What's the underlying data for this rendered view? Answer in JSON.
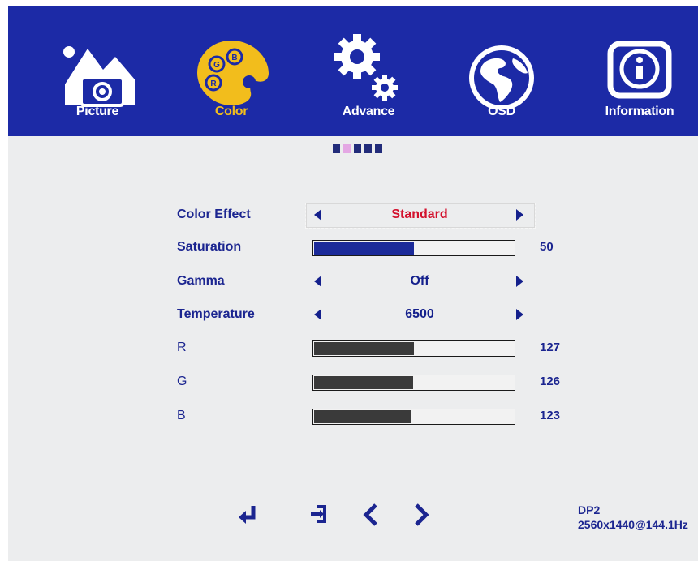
{
  "tabs": [
    {
      "label": "Picture",
      "icon": "picture-icon"
    },
    {
      "label": "Color",
      "icon": "palette-icon"
    },
    {
      "label": "Advance",
      "icon": "gears-icon"
    },
    {
      "label": "OSD",
      "icon": "globe-icon"
    },
    {
      "label": "Information",
      "icon": "info-icon"
    }
  ],
  "active_tab": "Color",
  "page_indicator": {
    "count": 5,
    "active_index": 1
  },
  "colors": {
    "bar_background": "#1c2aa6",
    "active_tab": "#f2bd1c",
    "selected_value": "#d3112d",
    "text": "#1b2590"
  },
  "settings": {
    "color_effect": {
      "label": "Color Effect",
      "value": "Standard"
    },
    "saturation": {
      "label": "Saturation",
      "value": "50",
      "level": 0.5
    },
    "gamma": {
      "label": "Gamma",
      "value": "Off"
    },
    "temperature": {
      "label": "Temperature",
      "value": "6500"
    },
    "r": {
      "label": "R",
      "value": "127",
      "level": 0.498
    },
    "g": {
      "label": "G",
      "value": "126",
      "level": 0.494
    },
    "b": {
      "label": "B",
      "value": "123",
      "level": 0.482
    }
  },
  "palette_letters": {
    "b": "B",
    "g": "G",
    "r": "R"
  },
  "bottom_icons": [
    "enter-icon",
    "exit-icon",
    "left-icon",
    "right-icon"
  ],
  "source": {
    "input": "DP2",
    "resolution": "2560x1440@144.1Hz"
  }
}
